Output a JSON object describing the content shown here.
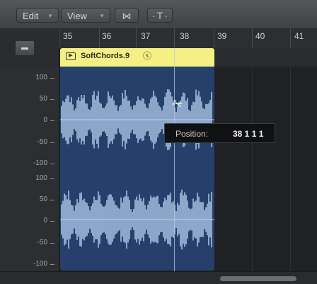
{
  "toolbar": {
    "edit_label": "Edit",
    "view_label": "View",
    "catch_icon": "bowtie-icon",
    "flex_icon": "flex-tool-icon"
  },
  "ruler": {
    "bars": [
      "35",
      "36",
      "37",
      "38",
      "39",
      "40",
      "41"
    ]
  },
  "region": {
    "name": "SoftChords.9",
    "color": "#f6f084",
    "body_color": "#27406b",
    "waveform_color": "#b9d2f2"
  },
  "scale": {
    "labels": [
      "100",
      "50",
      "0",
      "-50",
      "-100",
      "100",
      "50",
      "0",
      "-50",
      "-100"
    ]
  },
  "tooltip": {
    "label": "Position:",
    "value": "38 1 1 1"
  }
}
